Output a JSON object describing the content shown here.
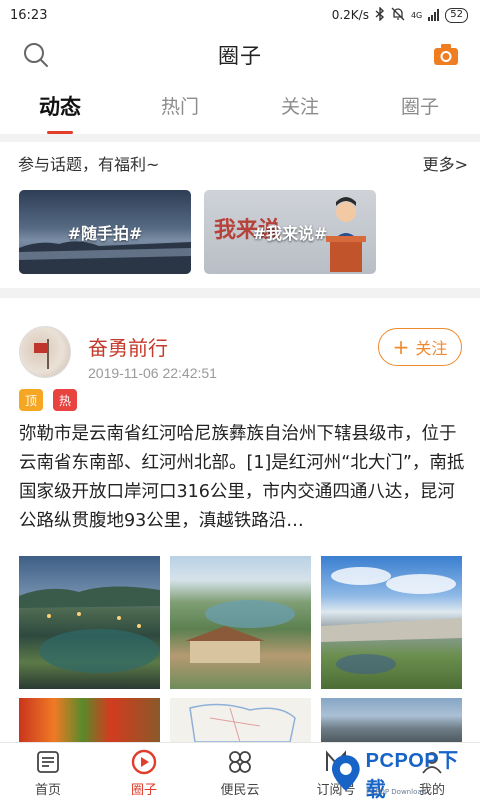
{
  "status_bar": {
    "time": "16:23",
    "speed": "0.2K/s",
    "network": "4G",
    "battery": "52"
  },
  "header": {
    "title": "圈子"
  },
  "tabs": [
    {
      "label": "动态",
      "active": true
    },
    {
      "label": "热门",
      "active": false
    },
    {
      "label": "关注",
      "active": false
    },
    {
      "label": "圈子",
      "active": false
    }
  ],
  "topics": {
    "title": "参与话题，有福利~",
    "more": "更多>",
    "cards": [
      {
        "label": "#随手拍#"
      },
      {
        "label": "#我来说#",
        "brush_text": "我来说"
      }
    ]
  },
  "post": {
    "author": "奋勇前行",
    "time": "2019-11-06 22:42:51",
    "follow_label": "关注",
    "badges": [
      "顶",
      "热"
    ],
    "body": "弥勒市是云南省红河哈尼族彝族自治州下辖县级市，位于云南省东南部、红河州北部。[1]是红河州“北大门”，南抵国家级开放口岸河口316公里，市内交通四通八达，昆河公路纵贯腹地93公里，滇越铁路沿…"
  },
  "bottom_nav": [
    {
      "label": "首页",
      "icon": "news-icon",
      "active": false
    },
    {
      "label": "圈子",
      "icon": "circle-play-icon",
      "active": true
    },
    {
      "label": "便民云",
      "icon": "grid-icon",
      "active": false
    },
    {
      "label": "订阅号",
      "icon": "subscribe-icon",
      "active": false
    },
    {
      "label": "我的",
      "icon": "person-icon",
      "active": false
    }
  ],
  "watermark": {
    "text": "PCPOP下载",
    "sub": "PCPOP Download"
  },
  "colors": {
    "accent": "#e23d2b",
    "follow": "#f08a2e",
    "badge_top": "#f5a623",
    "badge_hot": "#e8433f"
  }
}
